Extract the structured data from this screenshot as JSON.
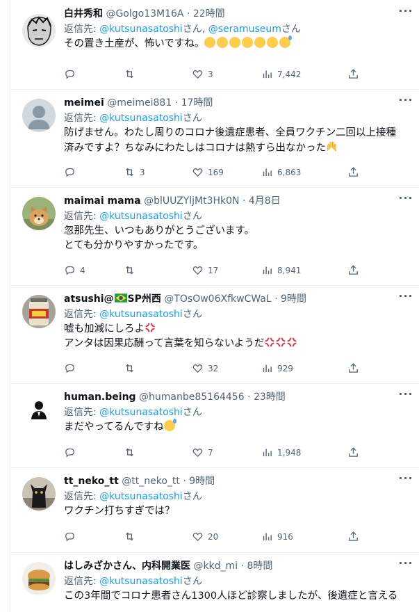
{
  "reply_prefix": "返信先: ",
  "reply_suffix": "さん",
  "tweets": [
    {
      "display_name": "白井秀和",
      "handle": "@Golgo13M16A",
      "separator": "·",
      "time": "22時間",
      "reply_to": [
        "@kutsunasatoshi",
        "@seramuseum"
      ],
      "reply_joiner": "さん, ",
      "lines": [
        "その置き土産が、怖いですね。"
      ],
      "replies": "",
      "retweets": "",
      "likes": "3",
      "views": "7,442"
    },
    {
      "display_name": "meimei",
      "handle": "@meimei881",
      "separator": "·",
      "time": "17時間",
      "reply_to": [
        "@kutsunasatoshi"
      ],
      "lines": [
        "防げません。わたし周りのコロナ後遺症患者、全員ワクチン二回以上接種",
        "済みですよ？ちなみにわたしはコロナは熱すら出なかった"
      ],
      "replies": "",
      "retweets": "3",
      "likes": "169",
      "views": "6,863"
    },
    {
      "display_name": "maimai mama",
      "handle": "@blUUZYljMt3Hk0N",
      "separator": "·",
      "time": "4月8日",
      "reply_to": [
        "@kutsunasatoshi"
      ],
      "lines": [
        "忽那先生、いつもありがとうございます。",
        "とても分かりやすかったです。"
      ],
      "replies": "4",
      "retweets": "",
      "likes": "17",
      "views": "8,941"
    },
    {
      "display_name": "atsushi@",
      "display_name_suffix": "SP州西",
      "handle": "@TOsOw06XfkwCWaL",
      "separator": "·",
      "time": "9時間",
      "reply_to": [
        "@kutsunasatoshi"
      ],
      "lines": [
        "嘘も加減にしろよ",
        "アンタは因果応酬って言葉を知らないようだ"
      ],
      "replies": "",
      "retweets": "",
      "likes": "32",
      "views": "929"
    },
    {
      "display_name": "human.being",
      "handle": "@humanbe85164456",
      "separator": "·",
      "time": "23時間",
      "reply_to": [
        "@kutsunasatoshi"
      ],
      "lines": [
        "まだやってるんですね"
      ],
      "replies": "",
      "retweets": "",
      "likes": "7",
      "views": "1,948"
    },
    {
      "display_name": "tt_neko_tt",
      "handle": "@tt_neko_tt",
      "separator": "·",
      "time": "9時間",
      "reply_to": [
        "@kutsunasatoshi"
      ],
      "lines": [
        "ワクチン打ちすぎでは？"
      ],
      "replies": "",
      "retweets": "",
      "likes": "20",
      "views": "916"
    },
    {
      "display_name": "はしみざかさん、内科開業医",
      "handle": "@kkd_mi",
      "separator": "·",
      "time": "8時間",
      "reply_to": [
        "@kutsunasatoshi"
      ],
      "lines": [
        "この3年間でコロナ患者さん1300人ほど診察しましたが、後遺症と言える"
      ]
    }
  ],
  "colors": {
    "accent": "#1d9bf0",
    "secondary_text": "#536471",
    "text": "#0f1419",
    "border": "#eff3f4"
  },
  "icons": [
    "reply-icon",
    "retweet-icon",
    "like-icon",
    "views-icon",
    "share-icon",
    "more-icon"
  ]
}
